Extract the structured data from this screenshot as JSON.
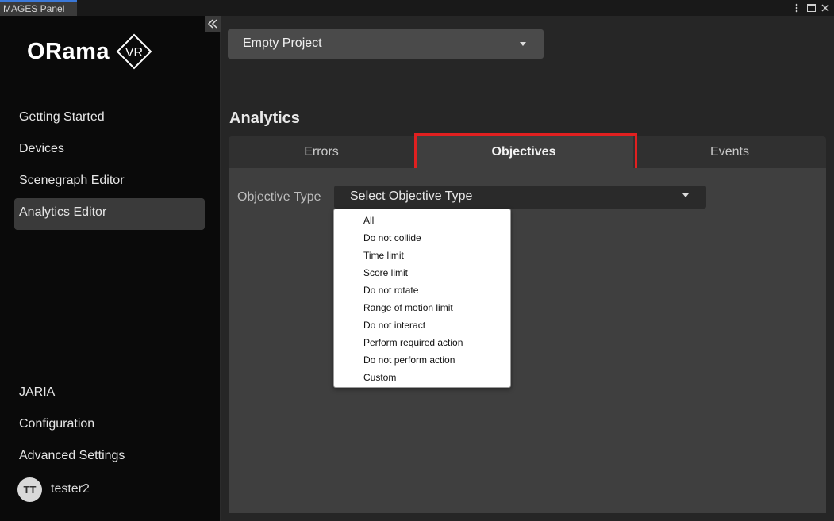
{
  "window": {
    "tab_title": "MAGES Panel",
    "controls": [
      "more-icon",
      "maximize-icon",
      "close-icon"
    ]
  },
  "sidebar": {
    "logo_text": "ORama",
    "logo_badge": "VR",
    "nav_top": [
      {
        "label": "Getting Started",
        "active": false
      },
      {
        "label": "Devices",
        "active": false
      },
      {
        "label": "Scenegraph Editor",
        "active": false
      },
      {
        "label": "Analytics Editor",
        "active": true
      }
    ],
    "nav_bottom": [
      {
        "label": "JARIA"
      },
      {
        "label": "Configuration"
      },
      {
        "label": "Advanced Settings"
      }
    ],
    "user": {
      "initials": "TT",
      "name": "tester2"
    }
  },
  "main": {
    "project_select": "Empty Project",
    "section_title": "Analytics",
    "tabs": [
      {
        "label": "Errors",
        "active": false
      },
      {
        "label": "Objectives",
        "active": true
      },
      {
        "label": "Events",
        "active": false
      }
    ],
    "objective_label": "Objective Type",
    "objective_select": "Select Objective Type",
    "objective_options": [
      "All",
      "Do not collide",
      "Time limit",
      "Score limit",
      "Do not rotate",
      "Range of motion limit",
      "Do not interact",
      "Perform required action",
      "Do not perform action",
      "Custom"
    ]
  },
  "colors": {
    "highlight": "#e02020",
    "sidebar_bg": "#0a0a0a",
    "main_bg": "#262626",
    "panel_bg": "#3f3f3f",
    "window_tab_accent": "#3b78d8"
  }
}
